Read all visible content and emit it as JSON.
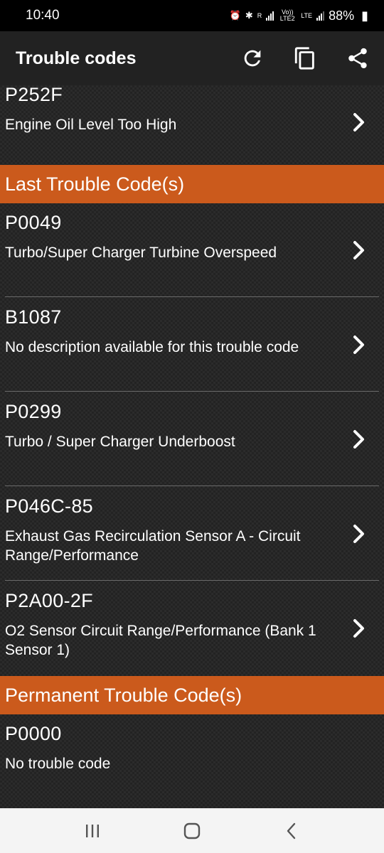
{
  "status_bar": {
    "time": "10:40",
    "battery": "88%",
    "network_r": "R",
    "network_volte": "Vo)) LTE2",
    "network_lte": "LTE"
  },
  "app_bar": {
    "title": "Trouble codes",
    "actions": [
      "refresh-icon",
      "copy-icon",
      "share-icon"
    ]
  },
  "top_item": {
    "code": "P252F",
    "description": "Engine Oil Level Too High"
  },
  "sections": {
    "last_title": "Last Trouble Code(s)",
    "last_items": [
      {
        "code": "P0049",
        "description": "Turbo/Super Charger Turbine Overspeed"
      },
      {
        "code": "B1087",
        "description": "No description available for this trouble code"
      },
      {
        "code": "P0299",
        "description": "Turbo / Super Charger Underboost"
      },
      {
        "code": "P046C-85",
        "description": "Exhaust Gas Recirculation Sensor A - Circuit Range/Performance"
      },
      {
        "code": "P2A00-2F",
        "description": "O2 Sensor Circuit Range/Performance (Bank 1 Sensor 1)"
      }
    ],
    "permanent_title": "Permanent Trouble Code(s)",
    "permanent_items": [
      {
        "code": "P0000",
        "description": "No trouble code"
      }
    ]
  },
  "colors": {
    "accent": "#cb5a1c",
    "app_bar": "#222222",
    "nav_bar": "#f4f4f4"
  },
  "nav": [
    "recent-apps-icon",
    "home-icon",
    "back-icon"
  ]
}
